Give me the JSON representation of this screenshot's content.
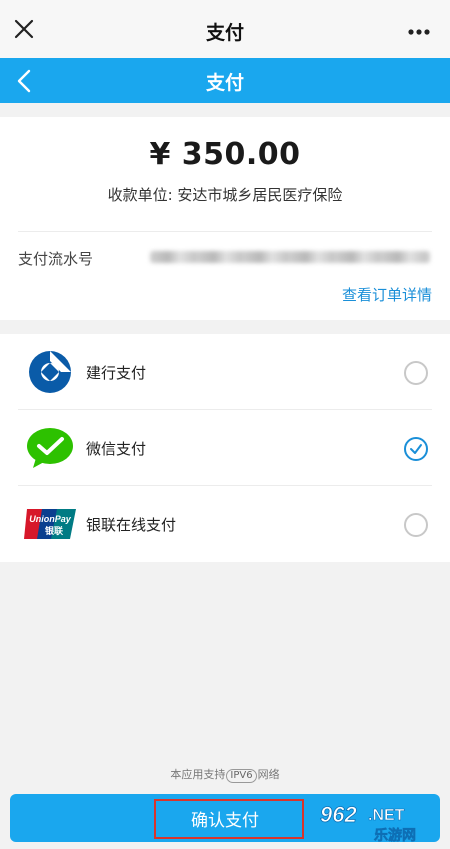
{
  "wechat_bar": {
    "title": "支付"
  },
  "app_bar": {
    "title": "支付"
  },
  "payment": {
    "amount": "¥ 350.00",
    "payee": "收款单位: 安达市城乡居民医疗保险",
    "serial_label": "支付流水号",
    "order_link": "查看订单详情"
  },
  "methods": [
    {
      "label": "建行支付",
      "icon": "ccb-logo-icon",
      "selected": false
    },
    {
      "label": "微信支付",
      "icon": "wechat-pay-icon",
      "selected": true
    },
    {
      "label": "银联在线支付",
      "icon": "unionpay-logo-icon",
      "selected": false
    }
  ],
  "unionpay_logo": {
    "en": "UnionPay",
    "cn": "银联"
  },
  "footer": {
    "ipv6_prefix": "本应用支持",
    "ipv6_badge": "IPV6",
    "ipv6_suffix": "网络",
    "confirm_label": "确认支付"
  },
  "watermark": {
    "number": "962",
    "suffix": ".NET",
    "cn": "乐游网"
  },
  "colors": {
    "primary": "#1aa7ee",
    "link": "#1a8fd8",
    "wechat_green": "#2dc100",
    "ccb_blue": "#0a5ba8",
    "highlight_red": "#d9342b"
  }
}
